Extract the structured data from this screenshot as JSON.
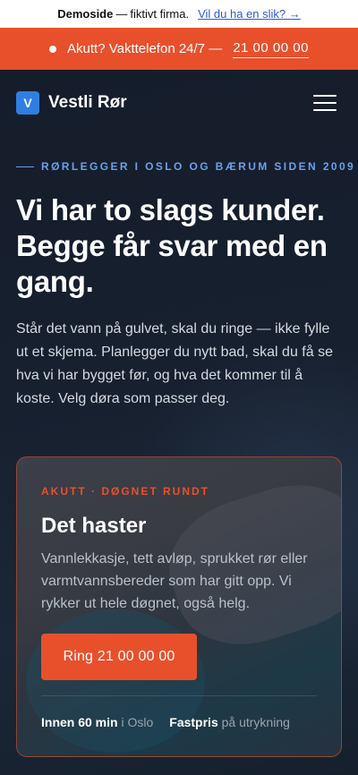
{
  "demo_bar": {
    "strong": "Demoside",
    "separator": "—",
    "text": "fiktivt firma.",
    "link": "Vil du ha en slik? →"
  },
  "alert_bar": {
    "text": "Akutt? Vakttelefon 24/7 —",
    "phone": "21 00 00 00"
  },
  "nav": {
    "logo_letter": "V",
    "brand": "Vestli Rør",
    "menu_icon": "hamburger-menu-icon"
  },
  "hero": {
    "eyebrow": "RØRLEGGER I OSLO OG BÆRUM SIDEN 2009",
    "headline": "Vi har to slags kunder. Begge får svar med en gang.",
    "lead": "Står det vann på gulvet, skal du ringe — ikke fylle ut et skjema. Planlegger du nytt bad, skal du få se hva vi har bygget før, og hva det kommer til å koste. Velg døra som passer deg."
  },
  "card": {
    "tag": "AKUTT · DØGNET RUNDT",
    "title": "Det haster",
    "text": "Vannlekkasje, tett avløp, sprukket rør eller varmtvannsbereder som har gitt opp. Vi rykker ut hele døgnet, også helg.",
    "cta": "Ring 21 00 00 00",
    "facts": [
      {
        "strong": "Innen 60 min",
        "rest": "i Oslo"
      },
      {
        "strong": "Fastpris",
        "rest": "på utrykning"
      }
    ]
  },
  "colors": {
    "accent": "#e8502c",
    "brand_blue": "#2f7fe0",
    "eyebrow": "#6ba0e8",
    "background": "#141c2a"
  }
}
